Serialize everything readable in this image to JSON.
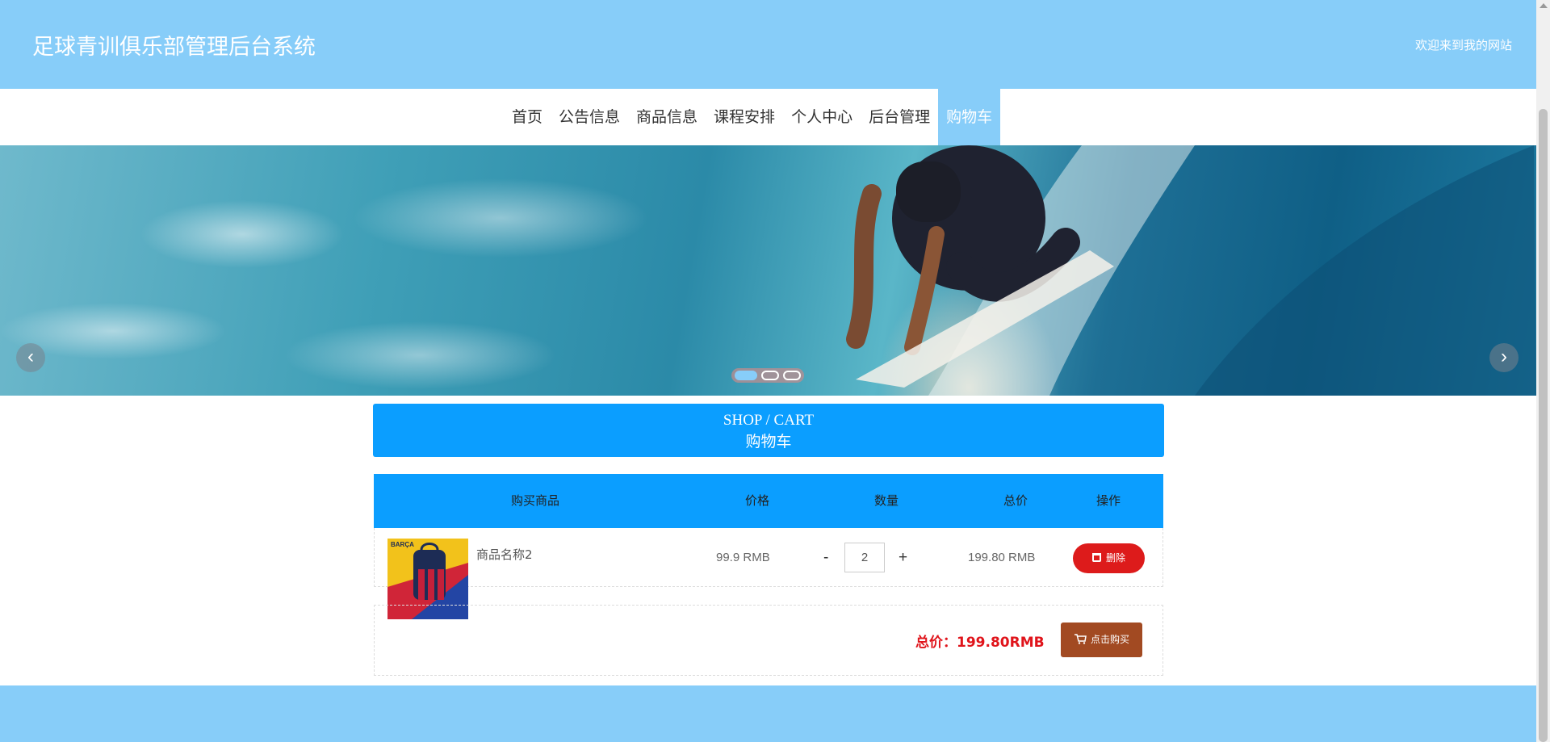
{
  "header": {
    "title": "足球青训俱乐部管理后台系统",
    "welcome": "欢迎来到我的网站"
  },
  "nav": {
    "items": [
      "首页",
      "公告信息",
      "商品信息",
      "课程安排",
      "个人中心",
      "后台管理",
      "购物车"
    ],
    "active_index": 6
  },
  "banner": {
    "prev_icon": "chevron-left-icon",
    "next_icon": "chevron-right-icon",
    "slide_count": 3,
    "active_slide": 0
  },
  "section": {
    "title_en": "SHOP / CART",
    "title_cn": "购物车"
  },
  "cart": {
    "columns": [
      "购买商品",
      "价格",
      "数量",
      "总价",
      "操作"
    ],
    "items": [
      {
        "name": "商品名称2",
        "image_text": "BARÇA",
        "price": "99.9 RMB",
        "quantity": "2",
        "minus": "-",
        "plus": "+",
        "subtotal": "199.80 RMB",
        "delete_label": "删除"
      }
    ],
    "total_label": "总价：199.80RMB",
    "buy_label": "点击购买"
  },
  "colors": {
    "header_bg": "#87cdf9",
    "primary_blue": "#0b9eff",
    "delete_red": "#dd1b1b",
    "buy_brown": "#a24a22",
    "total_red": "#e0141b"
  }
}
